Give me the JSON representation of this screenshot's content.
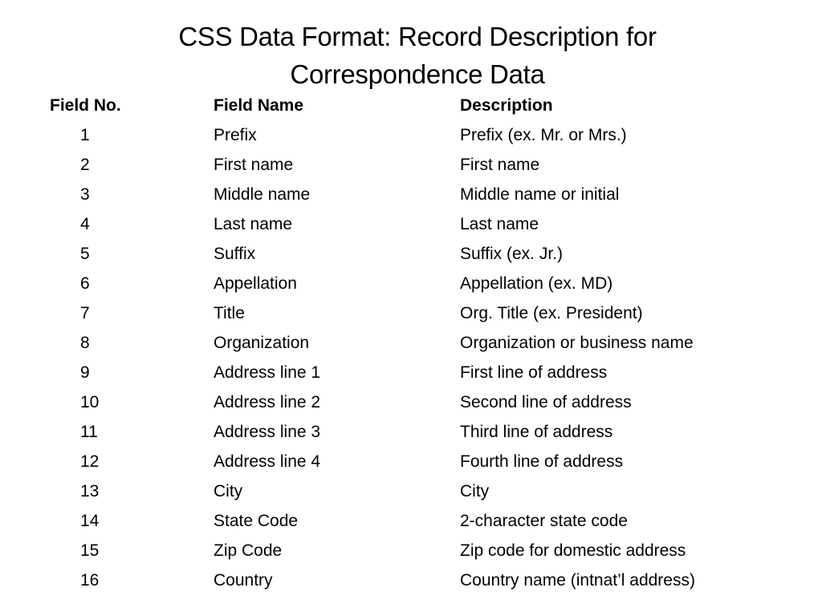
{
  "slide": {
    "title_line1": "CSS Data Format: Record Description for",
    "title_line2": "Correspondence Data"
  },
  "table": {
    "headers": {
      "field_no": "Field No.",
      "field_name": "Field Name",
      "description": "Description"
    },
    "rows": [
      {
        "no": "1",
        "name": "Prefix",
        "description": "Prefix (ex. Mr. or Mrs.)"
      },
      {
        "no": "2",
        "name": "First name",
        "description": "First name"
      },
      {
        "no": "3",
        "name": "Middle name",
        "description": "Middle name or initial"
      },
      {
        "no": "4",
        "name": "Last name",
        "description": "Last name"
      },
      {
        "no": "5",
        "name": "Suffix",
        "description": "Suffix (ex. Jr.)"
      },
      {
        "no": "6",
        "name": "Appellation",
        "description": "Appellation (ex. MD)"
      },
      {
        "no": "7",
        "name": "Title",
        "description": "Org. Title (ex. President)"
      },
      {
        "no": "8",
        "name": "Organization",
        "description": "Organization or business name"
      },
      {
        "no": "9",
        "name": "Address line 1",
        "description": "First line of address"
      },
      {
        "no": "10",
        "name": "Address line 2",
        "description": "Second line of address"
      },
      {
        "no": "11",
        "name": "Address line 3",
        "description": "Third line of address"
      },
      {
        "no": "12",
        "name": "Address line 4",
        "description": "Fourth line of address"
      },
      {
        "no": "13",
        "name": "City",
        "description": "City"
      },
      {
        "no": "14",
        "name": "State Code",
        "description": "2-character state code"
      },
      {
        "no": "15",
        "name": "Zip Code",
        "description": "Zip code for domestic address"
      },
      {
        "no": "16",
        "name": "Country",
        "description": "Country name (intnat’l address)"
      }
    ]
  }
}
